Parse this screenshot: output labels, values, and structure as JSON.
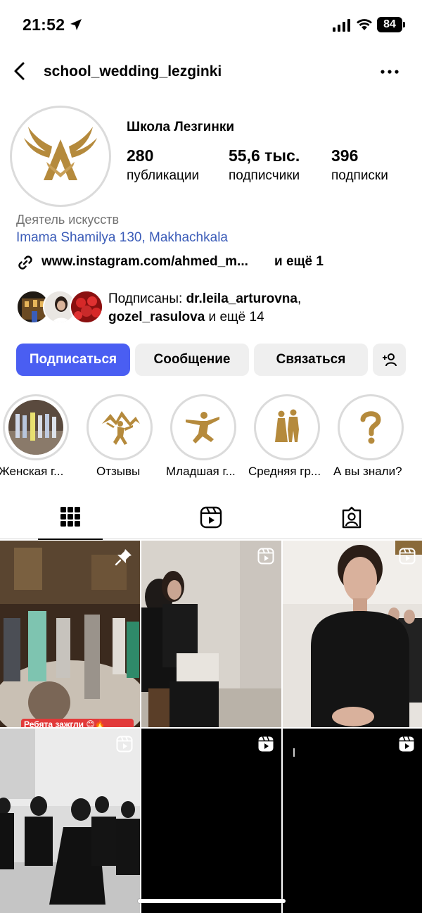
{
  "status_bar": {
    "time": "21:52",
    "battery": "84"
  },
  "nav": {
    "username": "school_wedding_lezginki"
  },
  "profile": {
    "name": "Школа Лезгинки",
    "stats": [
      {
        "value": "280",
        "label": "публикации"
      },
      {
        "value": "55,6 тыс.",
        "label": "подписчики"
      },
      {
        "value": "396",
        "label": "подписки"
      }
    ],
    "category": "Деятель искусств",
    "address": "Imama Shamilya 130, Makhachkala",
    "link": "www.instagram.com/ahmed_m...",
    "link_more": "и ещё 1"
  },
  "followed_by": {
    "prefix": "Подписаны: ",
    "user1": "dr.leila_arturovna",
    "sep": ",",
    "user2": "gozel_rasulova",
    "suffix": " и ещё 14"
  },
  "buttons": {
    "follow": "Подписаться",
    "message": "Сообщение",
    "contact": "Связаться"
  },
  "highlights": [
    {
      "label": "Женская г..."
    },
    {
      "label": "Отзывы"
    },
    {
      "label": "Младшая г..."
    },
    {
      "label": "Средняя гр..."
    },
    {
      "label": "А вы знали?"
    }
  ],
  "grid": {
    "caption_partial": "Ребята зажгли 😊🔥"
  },
  "colors": {
    "accent": "#4a5ef2",
    "link": "#3b5cb8",
    "gold": "#b58a3c"
  }
}
